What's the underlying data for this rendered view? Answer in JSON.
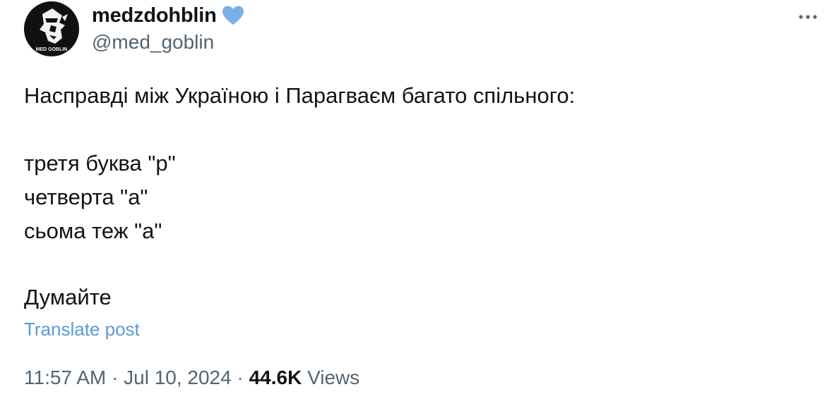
{
  "author": {
    "display_name": "medzdohblin",
    "handle": "@med_goblin",
    "avatar_text": "MED GOBLIN",
    "badge_icon": "blue-heart-icon",
    "badge_color": "#7ab0e8"
  },
  "tweet": {
    "lines": [
      "Насправді між Україною і Парагваєм багато спільного:",
      "третя буква \"р\"",
      "четверта \"а\"",
      "сьома теж \"а\"",
      "Думайте"
    ],
    "translate_label": "Translate post"
  },
  "meta": {
    "time": "11:57 AM",
    "separator": "·",
    "date": "Jul 10, 2024",
    "views_count": "44.6K",
    "views_label": "Views"
  },
  "menu": {
    "icon": "more-horizontal-icon"
  },
  "colors": {
    "text": "#0f1419",
    "secondary": "#536471",
    "link": "#5b9bd5"
  }
}
